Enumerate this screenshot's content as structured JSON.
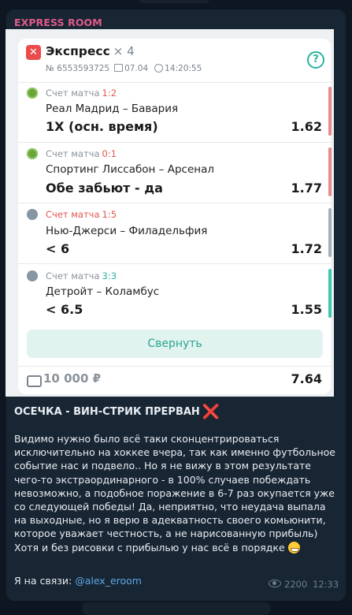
{
  "channel": {
    "name": "EXPRESS ROOM"
  },
  "card": {
    "title": "Экспресс",
    "count": "× 4",
    "number": "№ 6553593725",
    "date": "07.04",
    "time": "14:20:55",
    "bets": [
      {
        "score_label": "Счет матча",
        "score": "1:2",
        "score_color": "#e0574f",
        "teams": "Реал Мадрид – Бавария",
        "bet": "1X (осн. время)",
        "odd": "1.62",
        "sport_icon": "football-icon",
        "strip_color": "#e88a8a"
      },
      {
        "score_label": "Счет матча",
        "score": "0:1",
        "score_color": "#e0574f",
        "teams": "Спортинг Лиссабон – Арсенал",
        "bet": "Обе забьют - да",
        "odd": "1.77",
        "sport_icon": "football-icon",
        "strip_color": "#e88a8a"
      },
      {
        "score_label": "Счет матча",
        "score": "1:5",
        "score_color": "#e0574f",
        "teams": "Нью-Джерси – Филадельфия",
        "bet": "< 6",
        "odd": "1.72",
        "sport_icon": "hockey-icon",
        "strip_color": "#a6afb8"
      },
      {
        "score_label": "Счет матча",
        "score": "3:3",
        "score_color": "#2bb39f",
        "teams": "Детройт – Коламбус",
        "bet": "< 6.5",
        "odd": "1.55",
        "sport_icon": "hockey-icon",
        "strip_color": "#3cc7ae"
      }
    ],
    "collapse_label": "Свернуть",
    "stake": "10 000 ₽",
    "total_odd": "7.64"
  },
  "message": {
    "headline": "ОСЕЧКА - ВИН-СТРИК ПРЕРВАН",
    "headline_emoji": "❌",
    "body": "Видимо нужно было всё таки сконцентрироваться исключительно на хоккее вчера, так как именно футбольное событие нас и подвело.. Но я не вижу в этом результате чего-то экстраординарного - в 100% случаев побеждать невозможно, а подобное поражение в 6-7 раз окупается уже со следующей победы! Да, неприятно, что неудача выпала на выходные, но я верю в адекватность своего комьюнити, которое уважает честность, а не нарисованную прибыль) Хотя и без рисовки с прибылью у нас всё в порядке",
    "emoji": "😁",
    "contact_prefix": "Я на связи:",
    "contact_link": "@alex_eroom",
    "views": "2200",
    "time": "12:33"
  }
}
